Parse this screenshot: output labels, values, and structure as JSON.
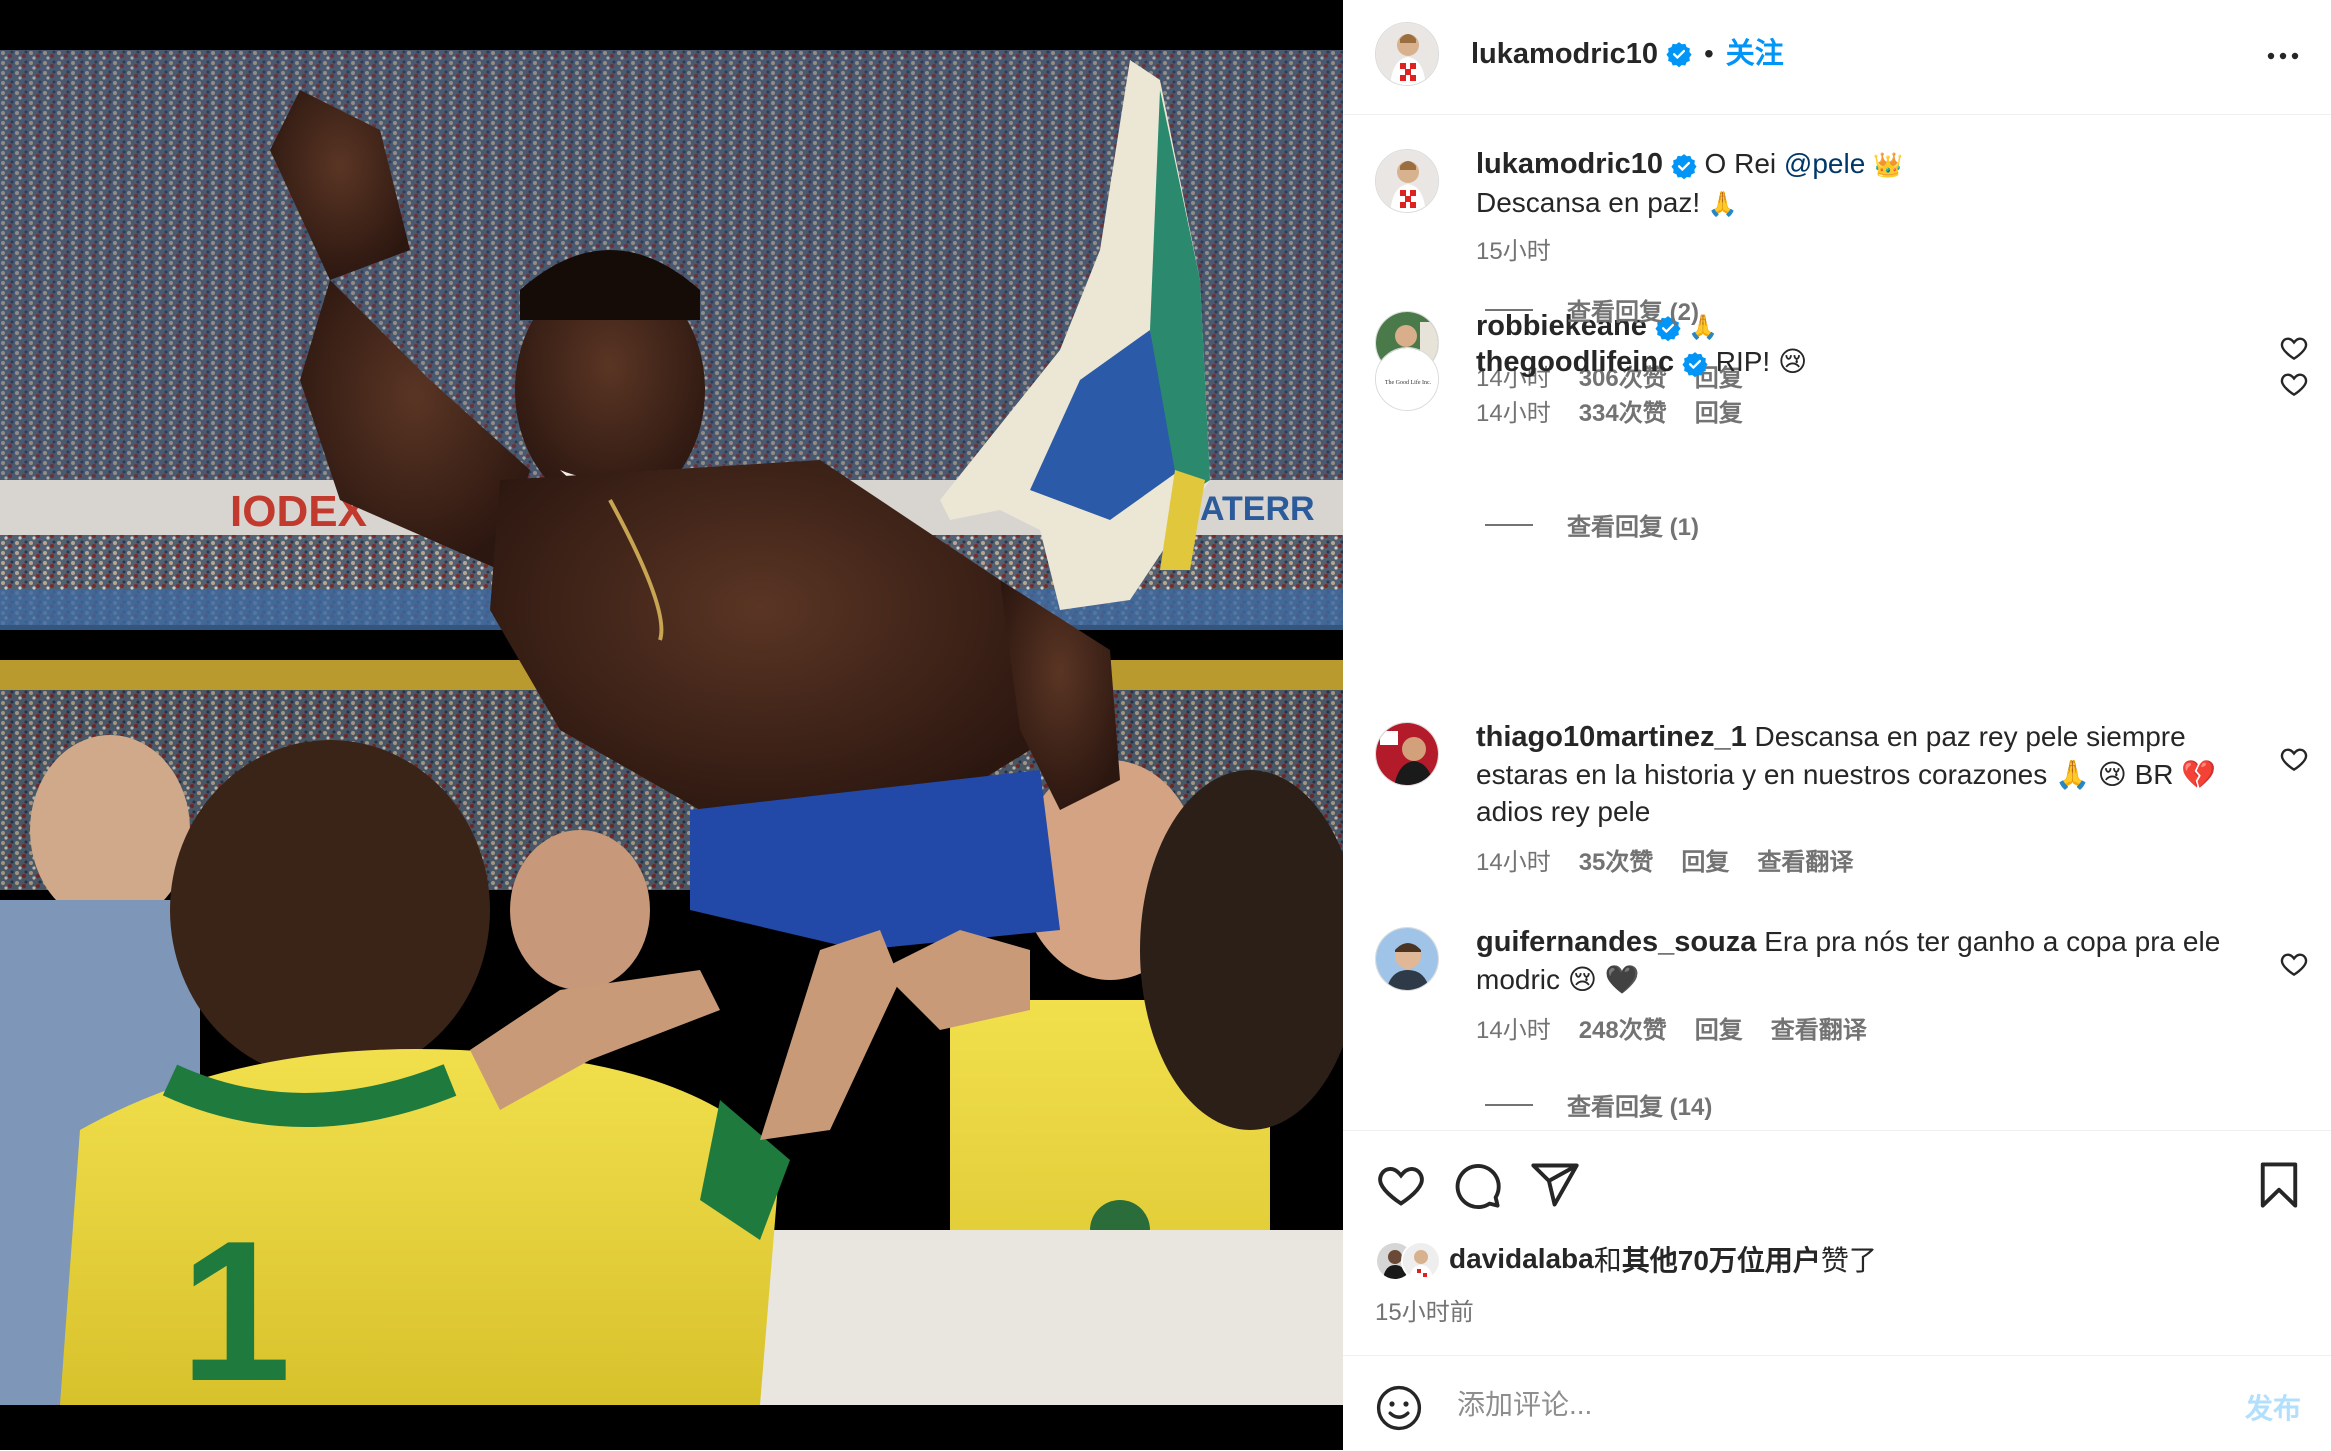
{
  "post": {
    "username": "lukamodric10",
    "follow_label": "关注",
    "dot": "•",
    "photo_text": {
      "jersey_number": "1",
      "banner_left": "IODEX",
      "banner_right": "ATERR"
    }
  },
  "caption": {
    "username": "lukamodric10",
    "text_prefix": "O Rei",
    "mention": "@pele",
    "emoji": "👑",
    "line2": "Descansa en paz!",
    "line2_emoji": "🙏",
    "time": "15小时"
  },
  "comments": [
    {
      "username": "robbiekeane",
      "verified": true,
      "text": "🙏",
      "time": "14小时",
      "likes": "306次赞",
      "reply": "回复",
      "view_replies": "查看回复 (2)"
    },
    {
      "username": "thegoodlifeinc",
      "verified": true,
      "text": "RIP! 😢",
      "time": "14小时",
      "likes": "334次赞",
      "reply": "回复",
      "view_replies": "查看回复 (1)",
      "avatar_text": "The Good Life Inc."
    },
    {
      "username": "thiago10martinez_1",
      "verified": false,
      "text": "Descansa en paz rey pele siempre estaras en la historia y en nuestros corazones 🙏 😢 BR 💔 adios rey pele",
      "time": "14小时",
      "likes": "35次赞",
      "reply": "回复",
      "translate": "查看翻译"
    },
    {
      "username": "guifernandes_souza",
      "verified": false,
      "text": "Era pra nós ter ganho a copa pra ele modric 😢 🖤",
      "time": "14小时",
      "likes": "248次赞",
      "reply": "回复",
      "translate": "查看翻译",
      "view_replies": "查看回复 (14)"
    }
  ],
  "icons": [
    "heart-icon",
    "comment-icon",
    "share-icon",
    "bookmark-icon",
    "more-icon",
    "verified-icon",
    "emoji-icon"
  ],
  "liked_by": {
    "user": "davidalaba",
    "conj": "和",
    "others": "其他70万位用户",
    "suffix": "赞了"
  },
  "post_time": "15小时前",
  "composer": {
    "placeholder": "添加评论...",
    "post_label": "发布"
  },
  "colors": {
    "accent": "#0095f6",
    "verified": "#0095f6",
    "post_disabled": "#b2dffc",
    "muted": "#737373"
  }
}
